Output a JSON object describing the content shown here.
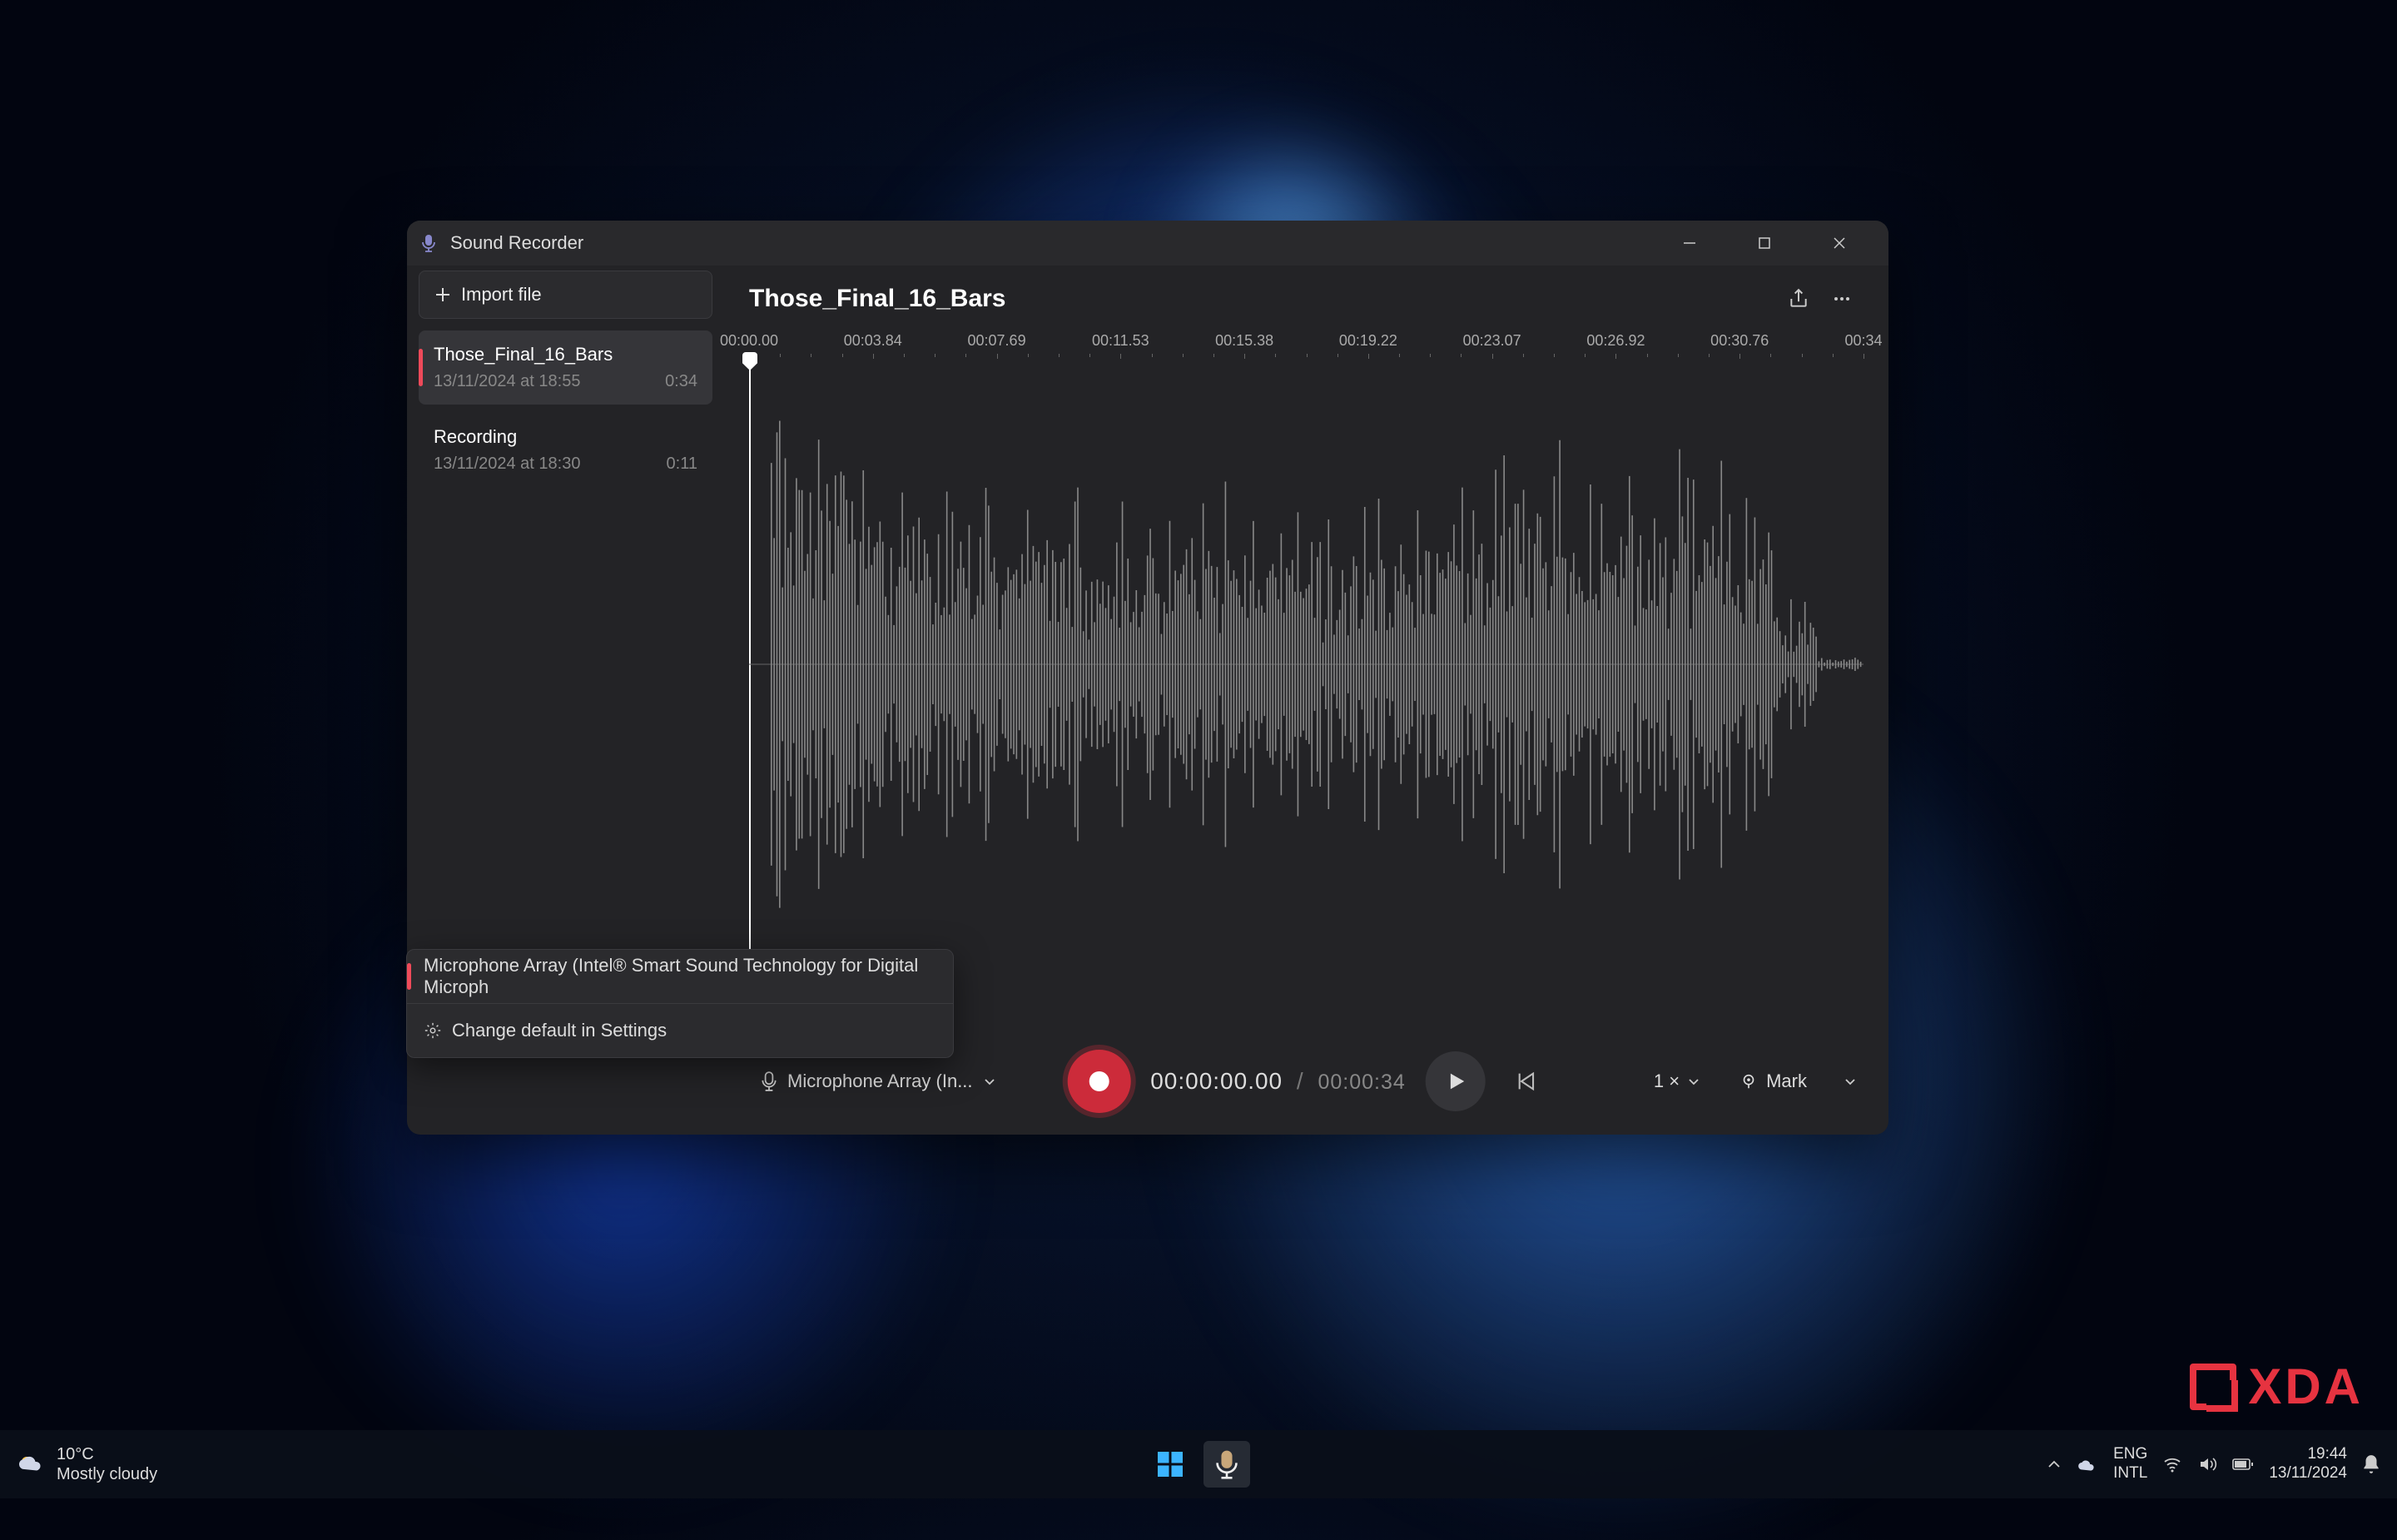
{
  "app": {
    "title": "Sound Recorder"
  },
  "sidebar": {
    "import_label": "Import file",
    "recordings": [
      {
        "name": "Those_Final_16_Bars",
        "date": "13/11/2024 at 18:55",
        "duration": "0:34"
      },
      {
        "name": "Recording",
        "date": "13/11/2024 at 18:30",
        "duration": "0:11"
      }
    ]
  },
  "main": {
    "title": "Those_Final_16_Bars",
    "ruler": [
      "00:00.00",
      "00:03.84",
      "00:07.69",
      "00:11.53",
      "00:15.38",
      "00:19.22",
      "00:23.07",
      "00:26.92",
      "00:30.76",
      "00:34"
    ]
  },
  "controls": {
    "mic_label": "Microphone Array (In...",
    "time_current": "00:00:00.00",
    "time_total": "00:00:34",
    "speed": "1 ×",
    "mark_label": "Mark"
  },
  "mic_popup": {
    "option": "Microphone Array (Intel® Smart Sound Technology for Digital Microph",
    "settings": "Change default in Settings"
  },
  "taskbar": {
    "weather_temp": "10°C",
    "weather_desc": "Mostly cloudy",
    "lang1": "ENG",
    "lang2": "INTL",
    "time": "19:44",
    "date": "13/11/2024"
  },
  "watermark": "XDA"
}
